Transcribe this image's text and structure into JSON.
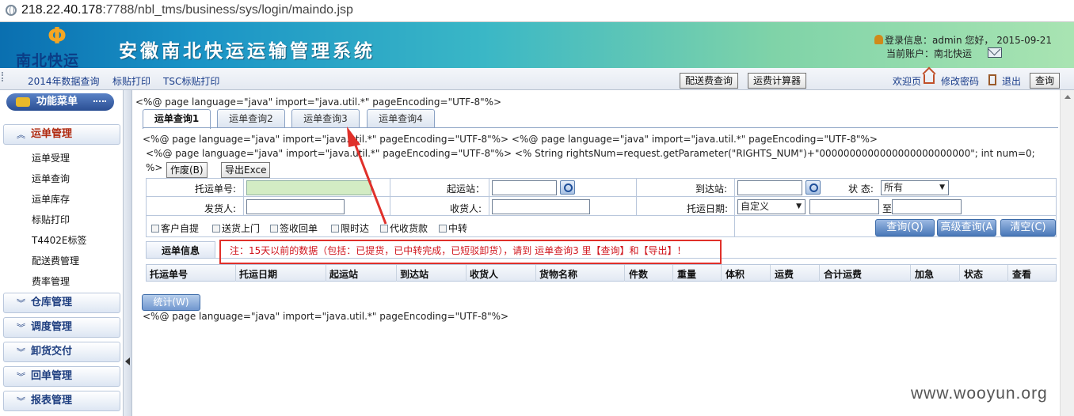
{
  "browser": {
    "url_host": "218.22.40.178",
    "url_path": ":7788/nbl_tms/business/sys/login/maindo.jsp"
  },
  "header": {
    "logo_text": "南北快运",
    "system_title": "安徽南北快运运输管理系统",
    "login_info": "登录信息：admin 您好，  2015-09-21",
    "current_account": "当前账户：南北快运"
  },
  "topnav": {
    "links": [
      "2014年数据查询",
      "标贴打印",
      "TSC标贴打印"
    ],
    "buttons": [
      "配送费查询",
      "运费计算器"
    ],
    "right": {
      "home": "欢迎页",
      "change_password": "修改密码",
      "logout": "退出",
      "query": "查询"
    }
  },
  "sidebar": {
    "menu_title": "功能菜单",
    "groups": [
      {
        "label": "运单管理",
        "open": true,
        "items": [
          "运单受理",
          "运单查询",
          "运单库存",
          "标贴打印",
          "T4402E标签",
          "配送费管理",
          "费率管理"
        ]
      },
      {
        "label": "仓库管理"
      },
      {
        "label": "调度管理"
      },
      {
        "label": "卸货交付"
      },
      {
        "label": "回单管理"
      },
      {
        "label": "报表管理"
      }
    ]
  },
  "main": {
    "jsp_lines": [
      "<%@ page language=\"java\" import=\"java.util.*\" pageEncoding=\"UTF-8\"%>",
      "<%@ page language=\"java\" import=\"java.util.*\" pageEncoding=\"UTF-8\"%> <%@ page language=\"java\" import=\"java.util.*\" pageEncoding=\"UTF-8\"%>",
      "<%@ page language=\"java\" import=\"java.util.*\" pageEncoding=\"UTF-8\"%> <% String rightsNum=request.getParameter(\"RIGHTS_NUM\")+\"0000000000000000000000000\"; int num=0;",
      "%>",
      "<%@ page language=\"java\" import=\"java.util.*\" pageEncoding=\"UTF-8\"%>"
    ],
    "tabs": [
      "运单查询1",
      "运单查询2",
      "运单查询3",
      "运单查询4"
    ],
    "actions": {
      "void": "作废(B)",
      "export": "导出Exce"
    },
    "form": {
      "waybill_no": "托运单号:",
      "origin": "起运站：",
      "destination": "到达站:",
      "status": "状 态:",
      "status_value": "所有",
      "shipper": "发货人:",
      "consignee": "收货人:",
      "date": "托运日期:",
      "date_mode": "自定义",
      "to": "至"
    },
    "checkboxes": [
      "客户自提",
      "送货上门",
      "签收回单",
      "限时达",
      "代收货款",
      "中转"
    ],
    "query_buttons": [
      "查询(Q)",
      "高级查询(A",
      "清空(C)"
    ],
    "info_tab": "运单信息",
    "notice": "注：15天以前的数据（包括：已提货，已中转完成，已短驳卸货），请到 运单查询3 里【查询】和【导出】！",
    "columns": [
      "托运单号",
      "托运日期",
      "起运站",
      "到达站",
      "收货人",
      "货物名称",
      "件数",
      "重量",
      "体积",
      "运费",
      "合计运费",
      "加急",
      "状态",
      "查看"
    ],
    "stat_button": "统计(W)"
  },
  "watermark": "www.wooyun.org",
  "colors": {
    "notice_red": "#d0141c",
    "annotation_red": "#e0302a",
    "menu_blue": "#2a4e93"
  }
}
